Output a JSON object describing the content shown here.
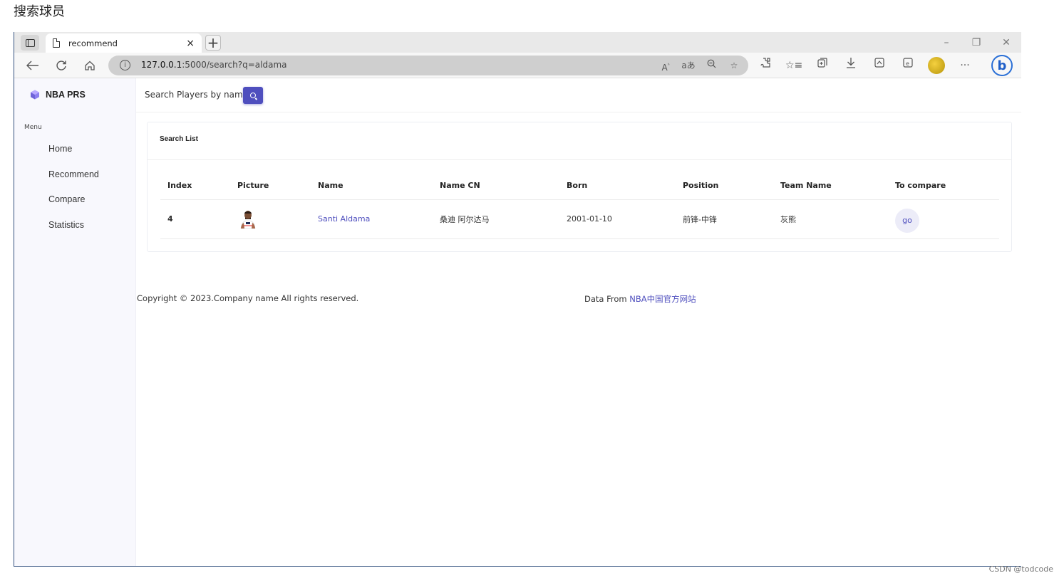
{
  "page_heading": "搜索球员",
  "browser": {
    "tab_title": "recommend",
    "tab_close": "×",
    "new_tab": "+",
    "window_controls": [
      "–",
      "❐",
      "✕"
    ],
    "url_host": "127.0.0.1",
    "url_rest": ":5000/search?q=aldama",
    "info_glyph": "i",
    "bing_glyph": "b"
  },
  "sidebar": {
    "brand": "NBA PRS",
    "menu_label": "Menu",
    "items": [
      {
        "label": "Home"
      },
      {
        "label": "Recommend"
      },
      {
        "label": "Compare"
      },
      {
        "label": "Statistics"
      }
    ]
  },
  "search": {
    "placeholder": "Search Players by name..."
  },
  "card": {
    "title": "Search List",
    "columns": [
      "Index",
      "Picture",
      "Name",
      "Name CN",
      "Born",
      "Position",
      "Team Name",
      "To compare"
    ],
    "rows": [
      {
        "index": "4",
        "name": "Santi Aldama",
        "name_cn": "桑迪 阿尔达马",
        "born": "2001-01-10",
        "position": "前锋-中锋",
        "team": "灰熊",
        "compare_label": "go"
      }
    ]
  },
  "footer": {
    "copyright": "Copyright © 2023.Company name All rights reserved.",
    "data_from_prefix": "Data From ",
    "data_from_link": "NBA中国官方网站"
  },
  "watermark": "CSDN @todcode",
  "colors": {
    "accent": "#4f4fbe",
    "sidebar_bg": "#f8f8fd",
    "go_bg": "#ececf8"
  }
}
